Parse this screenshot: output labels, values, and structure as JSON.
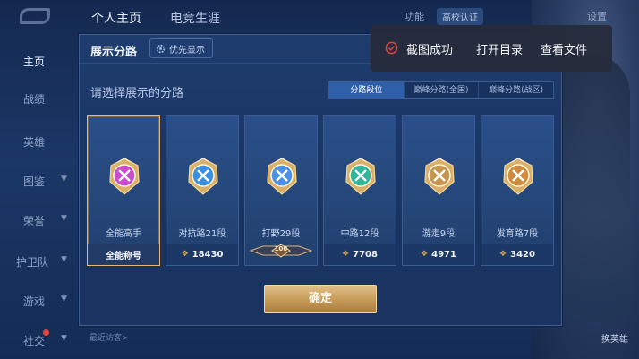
{
  "top_bar": {
    "tabs": [
      "个人主页",
      "电竞生涯"
    ],
    "feature_label": "功能",
    "school_auth_label": "高校认证",
    "settings_label": "设置"
  },
  "sidebar": {
    "items": [
      {
        "label": "主页"
      },
      {
        "label": "战绩"
      },
      {
        "label": "英雄"
      },
      {
        "label": "图鉴"
      },
      {
        "label": "荣誉"
      },
      {
        "label": "护卫队"
      },
      {
        "label": "游戏"
      },
      {
        "label": "社交"
      }
    ]
  },
  "bottom": {
    "recent_visitors": "最近访客>",
    "switch_hero": "换英雄"
  },
  "dialog": {
    "title": "展示分路",
    "priority_label": "优先显示",
    "prompt": "请选择展示的分路",
    "tabs": [
      "分路段位",
      "巅峰分路(全国)",
      "巅峰分路(战区)"
    ],
    "active_tab": 0,
    "cards": [
      {
        "lane": "全能高手",
        "value": "全能称号",
        "show_arrow": false,
        "emblem_color": "#c94bd0",
        "emblem": "allround-emblem-icon"
      },
      {
        "lane": "对抗路21段",
        "value": "18430",
        "show_arrow": true,
        "emblem_color": "#3b8fe0",
        "emblem": "clash-lane-emblem-icon"
      },
      {
        "lane": "打野29段",
        "value": "",
        "rank_badge": "100",
        "show_arrow": false,
        "emblem_color": "#4a90e6",
        "emblem": "jungle-emblem-icon"
      },
      {
        "lane": "中路12段",
        "value": "7708",
        "show_arrow": true,
        "emblem_color": "#2fb59a",
        "emblem": "mid-lane-emblem-icon"
      },
      {
        "lane": "游走9段",
        "value": "4971",
        "show_arrow": true,
        "emblem_color": "#c8954e",
        "emblem": "roam-emblem-icon"
      },
      {
        "lane": "发育路7段",
        "value": "3420",
        "show_arrow": true,
        "emblem_color": "#d08a3e",
        "emblem": "farm-lane-emblem-icon"
      }
    ],
    "selected_card": 0,
    "confirm_label": "确定"
  },
  "toast": {
    "message": "截图成功",
    "open_dir": "打开目录",
    "view_file": "查看文件"
  }
}
